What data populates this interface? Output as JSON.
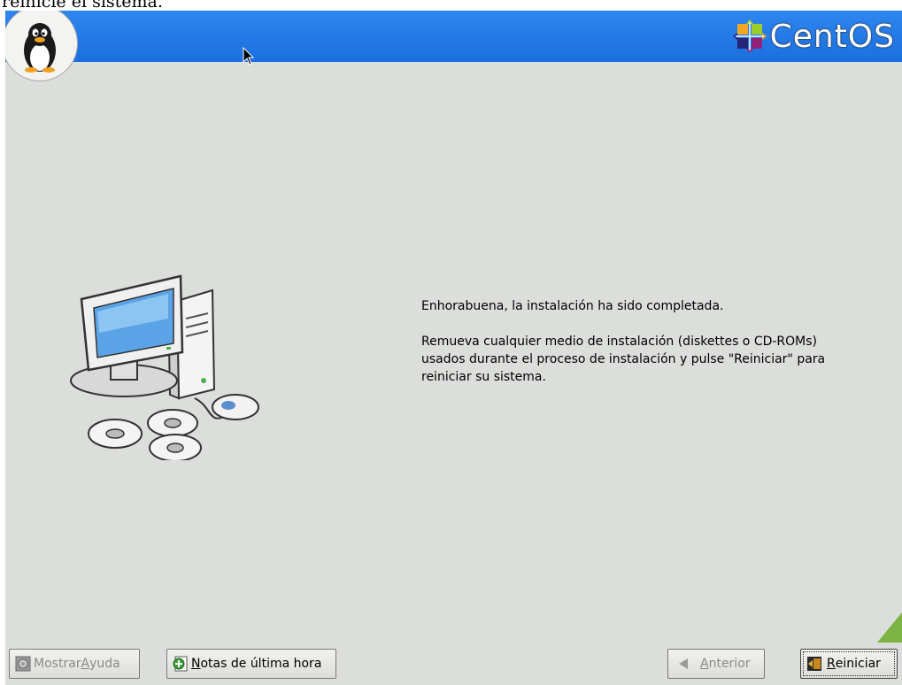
{
  "top_cropped_text": "reinicie el sistema.",
  "brand": {
    "name": "CentOS"
  },
  "message": {
    "line1": "Enhorabuena, la instalación ha sido completada.",
    "line2": "Remueva cualquier medio de instalación (diskettes o CD-ROMs) usados durante el proceso de instalación y pulse \"Reiniciar\" para reiniciar su sistema."
  },
  "buttons": {
    "help_prefix": "Mostrar ",
    "help_mnemonic": "A",
    "help_suffix": "yuda",
    "notes_mnemonic": "N",
    "notes_suffix": "otas de última hora",
    "back_mnemonic": "A",
    "back_suffix": "nterior",
    "reboot_mnemonic": "R",
    "reboot_suffix": "einiciar"
  },
  "colors": {
    "banner": "#1b6fe0",
    "window_bg": "#dcdedb"
  }
}
